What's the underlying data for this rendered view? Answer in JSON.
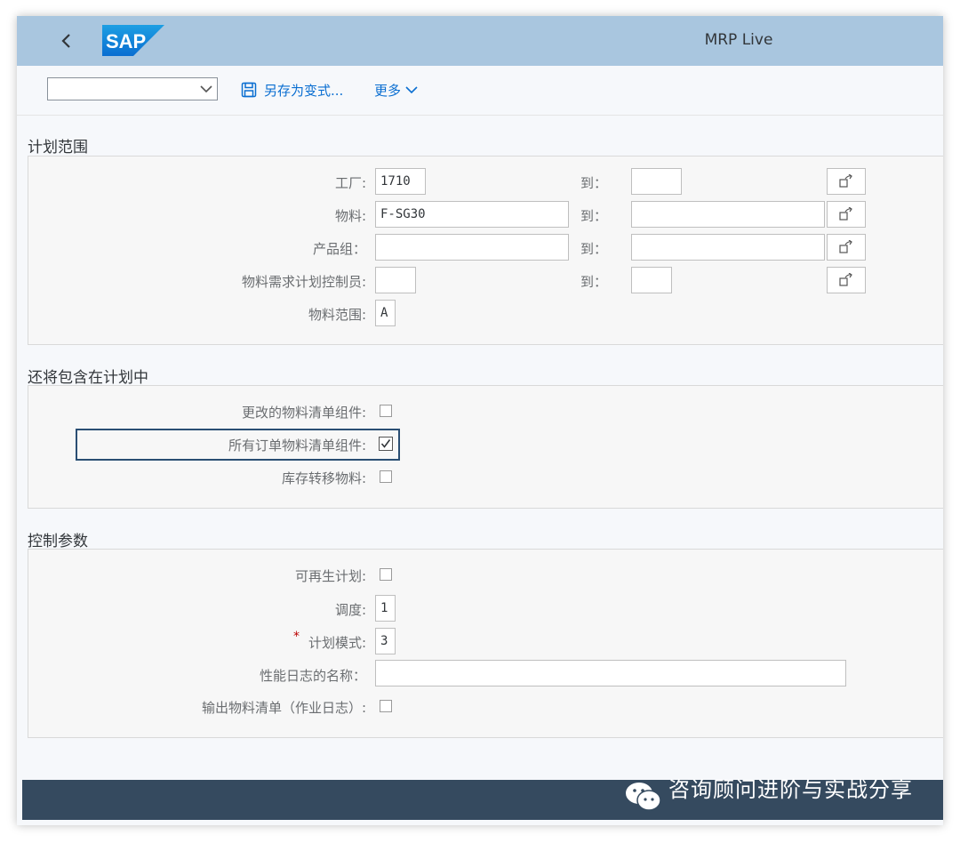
{
  "shell": {
    "logo_text": "SAP",
    "title": "MRP Live"
  },
  "toolbar": {
    "variant_value": "",
    "save_variant_label": "另存为变式...",
    "more_label": "更多"
  },
  "scope": {
    "title": "计划范围",
    "to_label": "到：",
    "rows": [
      {
        "label": "工厂:",
        "from": "1710",
        "to": ""
      },
      {
        "label": "物料:",
        "from": "F-SG30",
        "to": ""
      },
      {
        "label": "产品组：",
        "from": "",
        "to": ""
      },
      {
        "label": "物料需求计划控制员:",
        "from": "",
        "to": ""
      }
    ],
    "range_label": "物料范围:",
    "range_value": "A"
  },
  "include": {
    "title": "还将包含在计划中",
    "items": [
      {
        "label": "更改的物料清单组件:",
        "checked": false
      },
      {
        "label": "所有订单物料清单组件:",
        "checked": true
      },
      {
        "label": "库存转移物料:",
        "checked": false
      }
    ]
  },
  "control": {
    "title": "控制参数",
    "regen_label": "可再生计划:",
    "schedule_label": "调度:",
    "schedule_value": "1",
    "required_mark": "*",
    "mode_label": "计划模式:",
    "mode_value": "3",
    "log_name_label": "性能日志的名称：",
    "log_name_value": "",
    "bom_output_label": "输出物料清单（作业日志）:"
  },
  "watermark": {
    "text": "咨询顾问进阶与实战分享"
  },
  "colors": {
    "shell": "#a9c6df",
    "accent": "#0a6ed1",
    "footer": "#354a5f",
    "required": "#bb0000"
  }
}
